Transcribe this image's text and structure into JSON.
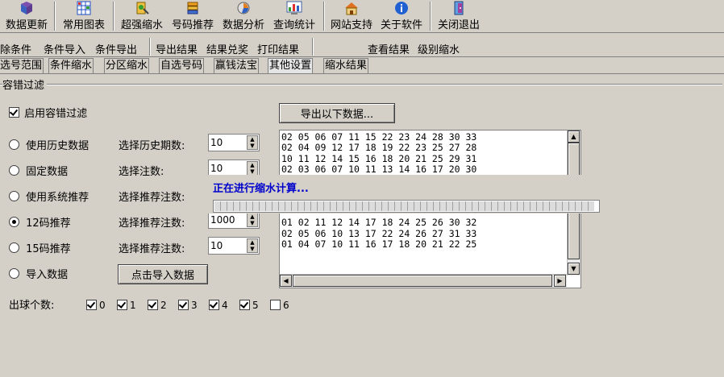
{
  "toolbar": {
    "items": [
      {
        "label": "数据更新",
        "icon": "book-icon"
      },
      {
        "label": "常用图表",
        "icon": "chart-grid-icon"
      },
      {
        "label": "超强缩水",
        "icon": "shrink-icon"
      },
      {
        "label": "号码推荐",
        "icon": "stack-icon"
      },
      {
        "label": "数据分析",
        "icon": "analysis-icon"
      },
      {
        "label": "查询统计",
        "icon": "stats-icon"
      },
      {
        "label": "网站支持",
        "icon": "home-icon"
      },
      {
        "label": "关于软件",
        "icon": "info-icon"
      },
      {
        "label": "关闭退出",
        "icon": "exit-icon"
      }
    ]
  },
  "toolbar2": {
    "items": [
      "删除条件",
      "条件导入",
      "条件导出",
      "导出结果",
      "结果兑奖",
      "打印结果",
      "查看结果",
      "级别缩水"
    ],
    "first_visible": "除条件"
  },
  "tabs": [
    {
      "label": "选号范围",
      "active": false
    },
    {
      "label": "条件缩水",
      "active": false
    },
    {
      "label": "分区缩水",
      "active": false
    },
    {
      "label": "自选号码",
      "active": false
    },
    {
      "label": "赢钱法宝",
      "active": false
    },
    {
      "label": "其他设置",
      "active": true
    },
    {
      "label": "缩水结果",
      "active": false
    }
  ],
  "group": {
    "title": "容错过滤"
  },
  "enable_filter": {
    "label": "启用容错过滤",
    "checked": true
  },
  "export_button": "导出以下数据...",
  "options": [
    {
      "label": "使用历史数据",
      "selected": false,
      "field_label": "选择历史期数:",
      "value": "10"
    },
    {
      "label": "固定数据",
      "selected": false,
      "field_label": "选择注数:",
      "value": "10"
    },
    {
      "label": "使用系统推荐",
      "selected": false,
      "field_label": "选择推荐注数:",
      "value": ""
    },
    {
      "label": "12码推荐",
      "selected": true,
      "field_label": "选择推荐注数:",
      "value": "1000"
    },
    {
      "label": "15码推荐",
      "selected": false,
      "field_label": "选择推荐注数:",
      "value": "10"
    },
    {
      "label": "导入数据",
      "selected": false
    }
  ],
  "import_button": "点击导入数据",
  "list_rows": [
    "02 05 06 07 11 15 22 23 24 28 30 33",
    "02 04 09 12 17 18 19 22 23 25 27 28",
    "10 11 12 14 15 16 18 20 21 25 29 31",
    "02 03 06 07 10 11 13 14 16 17 20 30",
    "",
    "",
    "",
    "",
    "01 02 11 12 14 17 18 24 25 26 30 32",
    "02 05 06 10 13 17 22 24 26 27 31 33",
    "01 04 07 10 11 16 17 18 20 21 22 25"
  ],
  "ball_count": {
    "label": "出球个数:",
    "items": [
      {
        "n": "0",
        "checked": true
      },
      {
        "n": "1",
        "checked": true
      },
      {
        "n": "2",
        "checked": true
      },
      {
        "n": "3",
        "checked": true
      },
      {
        "n": "4",
        "checked": true
      },
      {
        "n": "5",
        "checked": true
      },
      {
        "n": "6",
        "checked": false
      }
    ]
  },
  "progress": {
    "message": "正在进行缩水计算...",
    "fraction": 0.99
  },
  "colors": {
    "background": "#d4d0c8",
    "progress_text": "#0000cc"
  }
}
